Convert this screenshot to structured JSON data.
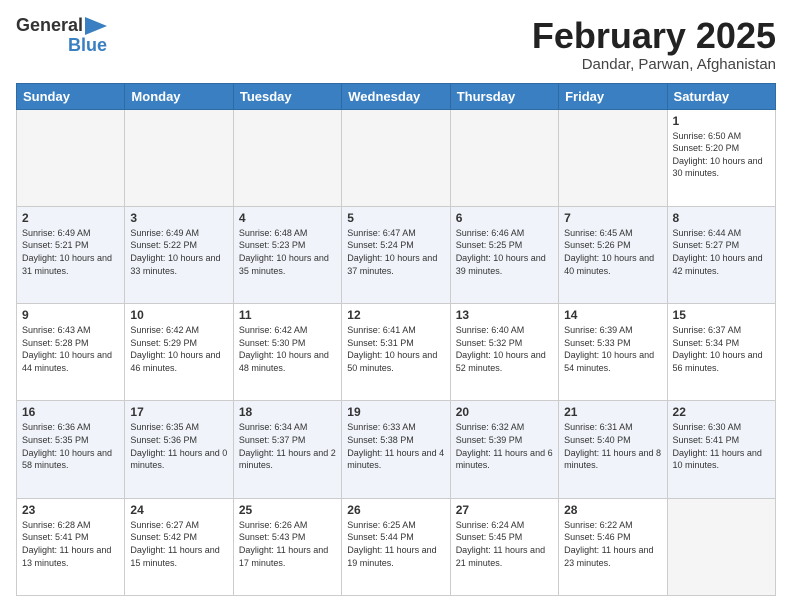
{
  "header": {
    "logo_general": "General",
    "logo_blue": "Blue",
    "month_title": "February 2025",
    "location": "Dandar, Parwan, Afghanistan"
  },
  "days_of_week": [
    "Sunday",
    "Monday",
    "Tuesday",
    "Wednesday",
    "Thursday",
    "Friday",
    "Saturday"
  ],
  "weeks": [
    [
      {
        "day": "",
        "info": ""
      },
      {
        "day": "",
        "info": ""
      },
      {
        "day": "",
        "info": ""
      },
      {
        "day": "",
        "info": ""
      },
      {
        "day": "",
        "info": ""
      },
      {
        "day": "",
        "info": ""
      },
      {
        "day": "1",
        "info": "Sunrise: 6:50 AM\nSunset: 5:20 PM\nDaylight: 10 hours and 30 minutes."
      }
    ],
    [
      {
        "day": "2",
        "info": "Sunrise: 6:49 AM\nSunset: 5:21 PM\nDaylight: 10 hours and 31 minutes."
      },
      {
        "day": "3",
        "info": "Sunrise: 6:49 AM\nSunset: 5:22 PM\nDaylight: 10 hours and 33 minutes."
      },
      {
        "day": "4",
        "info": "Sunrise: 6:48 AM\nSunset: 5:23 PM\nDaylight: 10 hours and 35 minutes."
      },
      {
        "day": "5",
        "info": "Sunrise: 6:47 AM\nSunset: 5:24 PM\nDaylight: 10 hours and 37 minutes."
      },
      {
        "day": "6",
        "info": "Sunrise: 6:46 AM\nSunset: 5:25 PM\nDaylight: 10 hours and 39 minutes."
      },
      {
        "day": "7",
        "info": "Sunrise: 6:45 AM\nSunset: 5:26 PM\nDaylight: 10 hours and 40 minutes."
      },
      {
        "day": "8",
        "info": "Sunrise: 6:44 AM\nSunset: 5:27 PM\nDaylight: 10 hours and 42 minutes."
      }
    ],
    [
      {
        "day": "9",
        "info": "Sunrise: 6:43 AM\nSunset: 5:28 PM\nDaylight: 10 hours and 44 minutes."
      },
      {
        "day": "10",
        "info": "Sunrise: 6:42 AM\nSunset: 5:29 PM\nDaylight: 10 hours and 46 minutes."
      },
      {
        "day": "11",
        "info": "Sunrise: 6:42 AM\nSunset: 5:30 PM\nDaylight: 10 hours and 48 minutes."
      },
      {
        "day": "12",
        "info": "Sunrise: 6:41 AM\nSunset: 5:31 PM\nDaylight: 10 hours and 50 minutes."
      },
      {
        "day": "13",
        "info": "Sunrise: 6:40 AM\nSunset: 5:32 PM\nDaylight: 10 hours and 52 minutes."
      },
      {
        "day": "14",
        "info": "Sunrise: 6:39 AM\nSunset: 5:33 PM\nDaylight: 10 hours and 54 minutes."
      },
      {
        "day": "15",
        "info": "Sunrise: 6:37 AM\nSunset: 5:34 PM\nDaylight: 10 hours and 56 minutes."
      }
    ],
    [
      {
        "day": "16",
        "info": "Sunrise: 6:36 AM\nSunset: 5:35 PM\nDaylight: 10 hours and 58 minutes."
      },
      {
        "day": "17",
        "info": "Sunrise: 6:35 AM\nSunset: 5:36 PM\nDaylight: 11 hours and 0 minutes."
      },
      {
        "day": "18",
        "info": "Sunrise: 6:34 AM\nSunset: 5:37 PM\nDaylight: 11 hours and 2 minutes."
      },
      {
        "day": "19",
        "info": "Sunrise: 6:33 AM\nSunset: 5:38 PM\nDaylight: 11 hours and 4 minutes."
      },
      {
        "day": "20",
        "info": "Sunrise: 6:32 AM\nSunset: 5:39 PM\nDaylight: 11 hours and 6 minutes."
      },
      {
        "day": "21",
        "info": "Sunrise: 6:31 AM\nSunset: 5:40 PM\nDaylight: 11 hours and 8 minutes."
      },
      {
        "day": "22",
        "info": "Sunrise: 6:30 AM\nSunset: 5:41 PM\nDaylight: 11 hours and 10 minutes."
      }
    ],
    [
      {
        "day": "23",
        "info": "Sunrise: 6:28 AM\nSunset: 5:41 PM\nDaylight: 11 hours and 13 minutes."
      },
      {
        "day": "24",
        "info": "Sunrise: 6:27 AM\nSunset: 5:42 PM\nDaylight: 11 hours and 15 minutes."
      },
      {
        "day": "25",
        "info": "Sunrise: 6:26 AM\nSunset: 5:43 PM\nDaylight: 11 hours and 17 minutes."
      },
      {
        "day": "26",
        "info": "Sunrise: 6:25 AM\nSunset: 5:44 PM\nDaylight: 11 hours and 19 minutes."
      },
      {
        "day": "27",
        "info": "Sunrise: 6:24 AM\nSunset: 5:45 PM\nDaylight: 11 hours and 21 minutes."
      },
      {
        "day": "28",
        "info": "Sunrise: 6:22 AM\nSunset: 5:46 PM\nDaylight: 11 hours and 23 minutes."
      },
      {
        "day": "",
        "info": ""
      }
    ]
  ]
}
